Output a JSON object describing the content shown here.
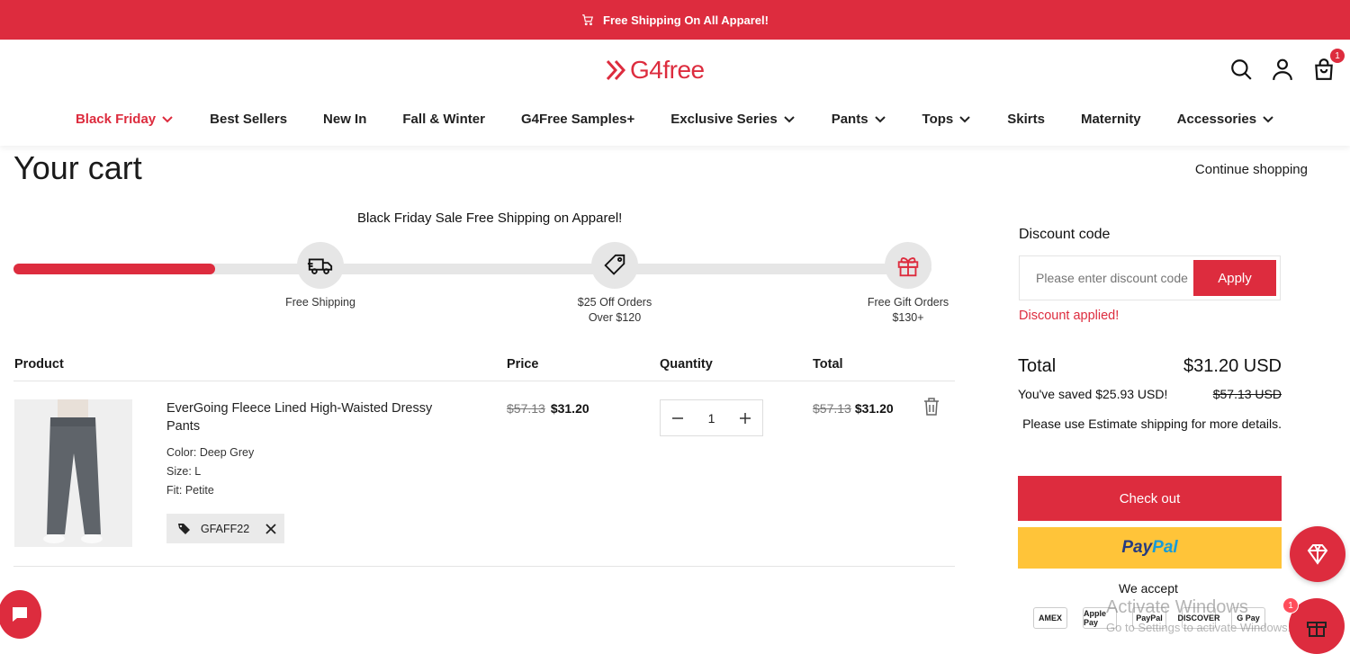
{
  "announcement": {
    "text": "Free Shipping On All Apparel!",
    "icon": "cart-icon"
  },
  "header": {
    "logo_text": "G4free",
    "cart_count": "1"
  },
  "nav": [
    {
      "label": "Black Friday",
      "dropdown": true,
      "highlight": true
    },
    {
      "label": "Best Sellers",
      "dropdown": false
    },
    {
      "label": "New In",
      "dropdown": false
    },
    {
      "label": "Fall & Winter",
      "dropdown": false
    },
    {
      "label": "G4Free Samples+",
      "dropdown": false
    },
    {
      "label": "Exclusive Series",
      "dropdown": true
    },
    {
      "label": "Pants",
      "dropdown": true
    },
    {
      "label": "Tops",
      "dropdown": true
    },
    {
      "label": "Skirts",
      "dropdown": false
    },
    {
      "label": "Maternity",
      "dropdown": false
    },
    {
      "label": "Accessories",
      "dropdown": true
    }
  ],
  "page": {
    "title": "Your cart",
    "continue_shopping": "Continue shopping"
  },
  "promo": {
    "title": "Black Friday Sale Free Shipping on Apparel!",
    "progress": 0.22,
    "milestones": [
      {
        "label": "Free Shipping",
        "icon": "truck-icon"
      },
      {
        "label": "$25 Off Orders Over $120",
        "line1": "$25 Off Orders",
        "line2": "Over $120",
        "icon": "tag-icon"
      },
      {
        "label": "Free Gift Orders $130+",
        "line1": "Free Gift Orders",
        "line2": "$130+",
        "icon": "gift-icon"
      }
    ]
  },
  "table": {
    "headers": {
      "product": "Product",
      "price": "Price",
      "quantity": "Quantity",
      "total": "Total"
    }
  },
  "item": {
    "name": "EverGoing Fleece Lined High-Waisted Dressy Pants",
    "color": "Color: Deep Grey",
    "size": "Size: L",
    "fit": "Fit: Petite",
    "coupon": "GFAFF22",
    "price_old": "$57.13",
    "price_new": "$31.20",
    "quantity": "1",
    "total_old": "$57.13",
    "total_new": "$31.20"
  },
  "summary": {
    "discount_label": "Discount code",
    "discount_placeholder": "Please enter discount code",
    "apply_label": "Apply",
    "discount_message": "Discount applied!",
    "total_label": "Total",
    "total_value": "$31.20 USD",
    "saved_text": "You've saved $25.93 USD!",
    "saved_original": "$57.13 USD",
    "shipping_note": "Please use Estimate shipping for more details.",
    "checkout_label": "Check out",
    "paypal_part1": "Pay",
    "paypal_part2": "Pal",
    "accept_label": "We accept",
    "payment_methods": [
      "AMEX",
      "Apple Pay",
      "PayPal",
      "DISCOVER",
      "G Pay"
    ]
  },
  "overlay": {
    "watermark_title": "Activate Windows",
    "watermark_sub": "Go to Settings to activate Windows."
  },
  "floating": {
    "gift_badge": "1"
  },
  "colors": {
    "brand": "#dd2c3e",
    "paypal_yellow": "#ffc439"
  }
}
